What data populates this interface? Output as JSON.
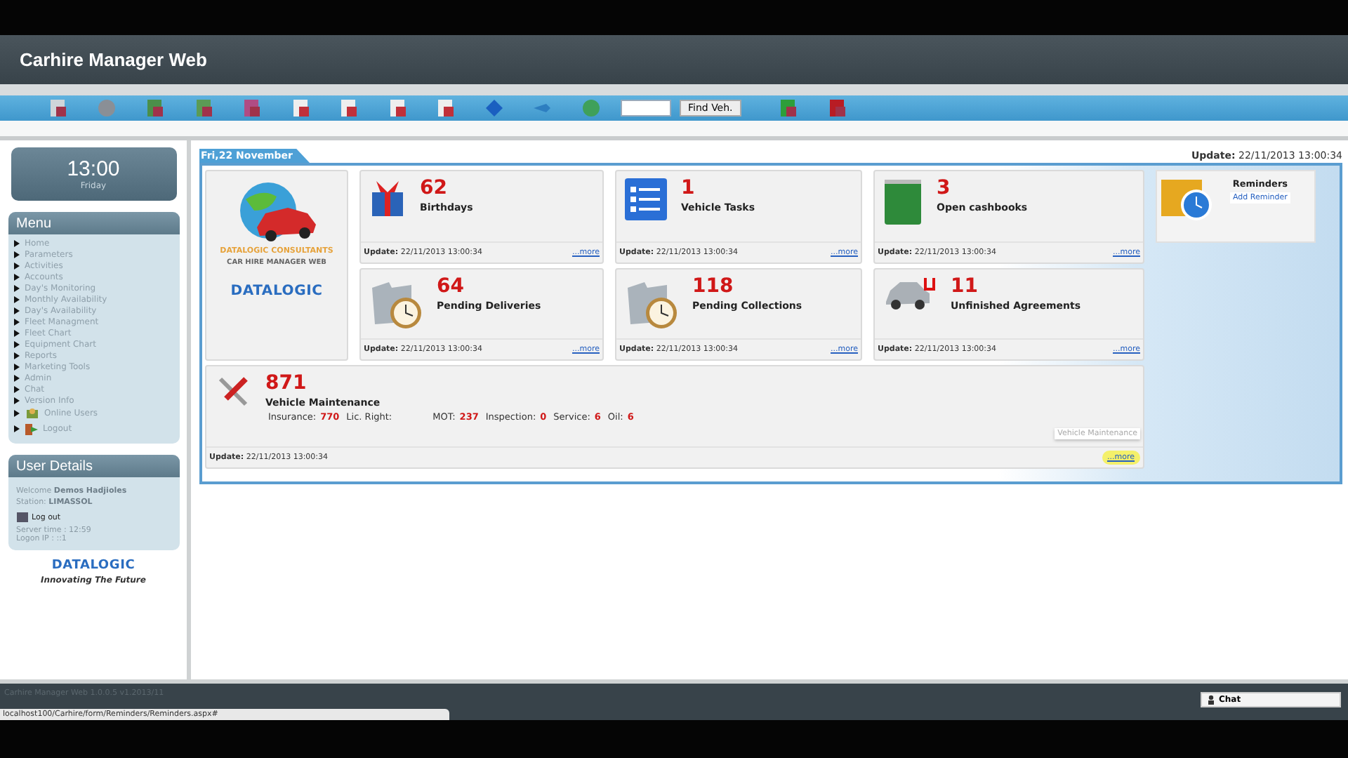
{
  "header": {
    "title": "Carhire Manager Web"
  },
  "toolbar": {
    "items": [
      {
        "kind": "icon"
      },
      {
        "kind": "icon"
      },
      {
        "kind": "icon"
      },
      {
        "kind": "icon"
      },
      {
        "kind": "icon"
      },
      {
        "kind": "icon"
      },
      {
        "kind": "icon"
      },
      {
        "kind": "icon"
      },
      {
        "kind": "icon"
      },
      {
        "kind": "icon"
      },
      {
        "kind": "icon"
      },
      {
        "kind": "icon"
      },
      {
        "kind": "field"
      },
      {
        "kind": "button",
        "label": "Find Veh."
      },
      {
        "kind": "icon"
      },
      {
        "kind": "icon"
      }
    ]
  },
  "clock": {
    "time": "13:00",
    "day": "Friday"
  },
  "menu": {
    "title": "Menu",
    "items": [
      {
        "label": "Home",
        "kind": "arrow"
      },
      {
        "label": "Parameters",
        "kind": "arrow"
      },
      {
        "label": "Activities",
        "kind": "arrow"
      },
      {
        "label": "Accounts",
        "kind": "arrow"
      },
      {
        "label": "Day's Monitoring",
        "kind": "arrow"
      },
      {
        "label": "Monthly Availability",
        "kind": "arrow"
      },
      {
        "label": "Day's Availability",
        "kind": "arrow"
      },
      {
        "label": "Fleet Managment",
        "kind": "arrow"
      },
      {
        "label": "Fleet Chart",
        "kind": "arrow"
      },
      {
        "label": "Equipment Chart",
        "kind": "arrow"
      },
      {
        "label": "Reports",
        "kind": "arrow"
      },
      {
        "label": "Marketing Tools",
        "kind": "arrow"
      },
      {
        "label": "Admin",
        "kind": "arrow"
      },
      {
        "label": "Chat",
        "kind": "arrow"
      },
      {
        "label": "Version Info",
        "kind": "arrow"
      },
      {
        "label": "Online Users",
        "kind": "users"
      },
      {
        "label": "Logout",
        "kind": "exit"
      }
    ]
  },
  "user_details": {
    "title": "User Details",
    "welcome": "Welcome **Demos Hadjioles**",
    "station": "Station: **LIMASSOL**",
    "logout": "Log out",
    "server_time": "Server time : 12:59",
    "logon_ip": "Logon IP : ::1"
  },
  "brand": {
    "logo": "DATALOGIC",
    "tagline": "Innovating The Future"
  },
  "dashboard": {
    "date_tab": "Fri,22 November",
    "update": "**Update:** 22/11/2013 13:00:34",
    "logo_tile": {
      "line_1": "DATALOGIC CONSULTANTS",
      "line_2": "CAR HIRE MANAGER WEB",
      "logo": "DATALOGIC"
    },
    "tiles": [
      {
        "count": "62",
        "label": "Birthdays",
        "update": "**Update:** 22/11/2013 13:00:34",
        "more": "...more"
      },
      {
        "count": "1",
        "label": "Vehicle Tasks",
        "update": "**Update:** 22/11/2013 13:00:34",
        "more": "...more"
      },
      {
        "count": "3",
        "label": "Open cashbooks",
        "update": "**Update:** 22/11/2013 13:00:34",
        "more": "...more"
      },
      {
        "count": "64",
        "label": "Pending Deliveries",
        "update": "**Update:** 22/11/2013 13:00:34",
        "more": "...more"
      },
      {
        "count": "118",
        "label": "Pending Collections",
        "update": "**Update:** 22/11/2013 13:00:34",
        "more": "...more"
      },
      {
        "count": "11",
        "label": "Unfinished Agreements",
        "update": "**Update:** 22/11/2013 13:00:34",
        "more": "...more"
      }
    ],
    "maintenance": {
      "count": "871",
      "label": "Vehicle Maintenance",
      "stats": [
        {
          "label": "Insurance:",
          "value": "770"
        },
        {
          "label": "Lic. Right:"
        },
        {
          "label": "MOT:",
          "value": "237"
        },
        {
          "label": "Inspection:",
          "value": "0"
        },
        {
          "label": "Service:",
          "value": "6"
        },
        {
          "label": "Oil:",
          "value": "6"
        }
      ],
      "update": "**Update:** 22/11/2013 13:00:34",
      "tooltip": "Vehicle Maintenance",
      "more": "...more"
    },
    "reminders": {
      "title": "Reminders",
      "link": "Add Reminder"
    }
  },
  "footer": {
    "version": "Carhire Manager Web 1.0.0.5 v1.2013/11",
    "url": "localhost100/Carhire/form/Reminders/Reminders.aspx#",
    "chat": "Chat"
  }
}
